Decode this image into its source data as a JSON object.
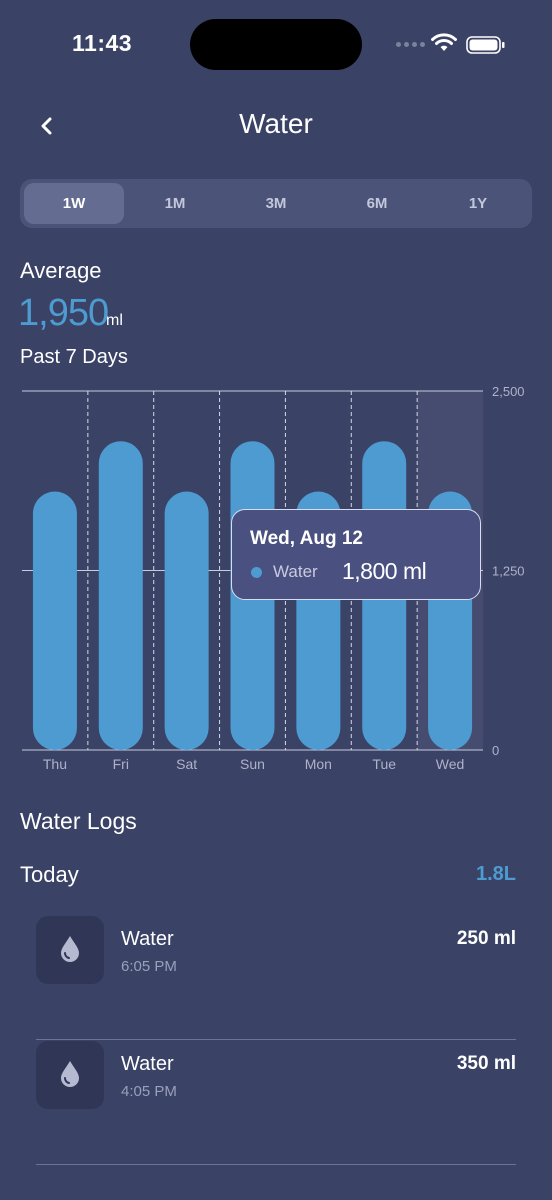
{
  "status": {
    "time": "11:43"
  },
  "header": {
    "title": "Water"
  },
  "tabs": [
    {
      "label": "1W"
    },
    {
      "label": "1M"
    },
    {
      "label": "3M"
    },
    {
      "label": "6M"
    },
    {
      "label": "1Y"
    }
  ],
  "summary": {
    "average_label": "Average",
    "average_value": "1,950",
    "unit": "ml",
    "period": "Past 7 Days"
  },
  "chart_data": {
    "type": "bar",
    "categories": [
      "Thu",
      "Fri",
      "Sat",
      "Sun",
      "Mon",
      "Tue",
      "Wed"
    ],
    "values": [
      1800,
      2150,
      1800,
      2150,
      1800,
      2150,
      1800
    ],
    "ylim": [
      0,
      2500
    ],
    "y_ticks": [
      "2,500",
      "1,250",
      "0"
    ],
    "highlight_index": 6,
    "colors": {
      "bar": "#4d9bd0",
      "highlight_column": "#454c70"
    },
    "grid": true
  },
  "tooltip": {
    "date": "Wed, Aug 12",
    "series_label": "Water",
    "value": "1,800 ml"
  },
  "logs": {
    "title": "Water Logs",
    "today_label": "Today",
    "today_total": "1.8L",
    "items": [
      {
        "name": "Water",
        "time": "6:05 PM",
        "amount": "250 ml",
        "icon": "water-drop-icon"
      },
      {
        "name": "Water",
        "time": "4:05 PM",
        "amount": "350 ml",
        "icon": "water-drop-icon"
      }
    ]
  },
  "colors": {
    "background": "#3a4266",
    "accent": "#4d9bd0",
    "card": "#4b5478"
  }
}
